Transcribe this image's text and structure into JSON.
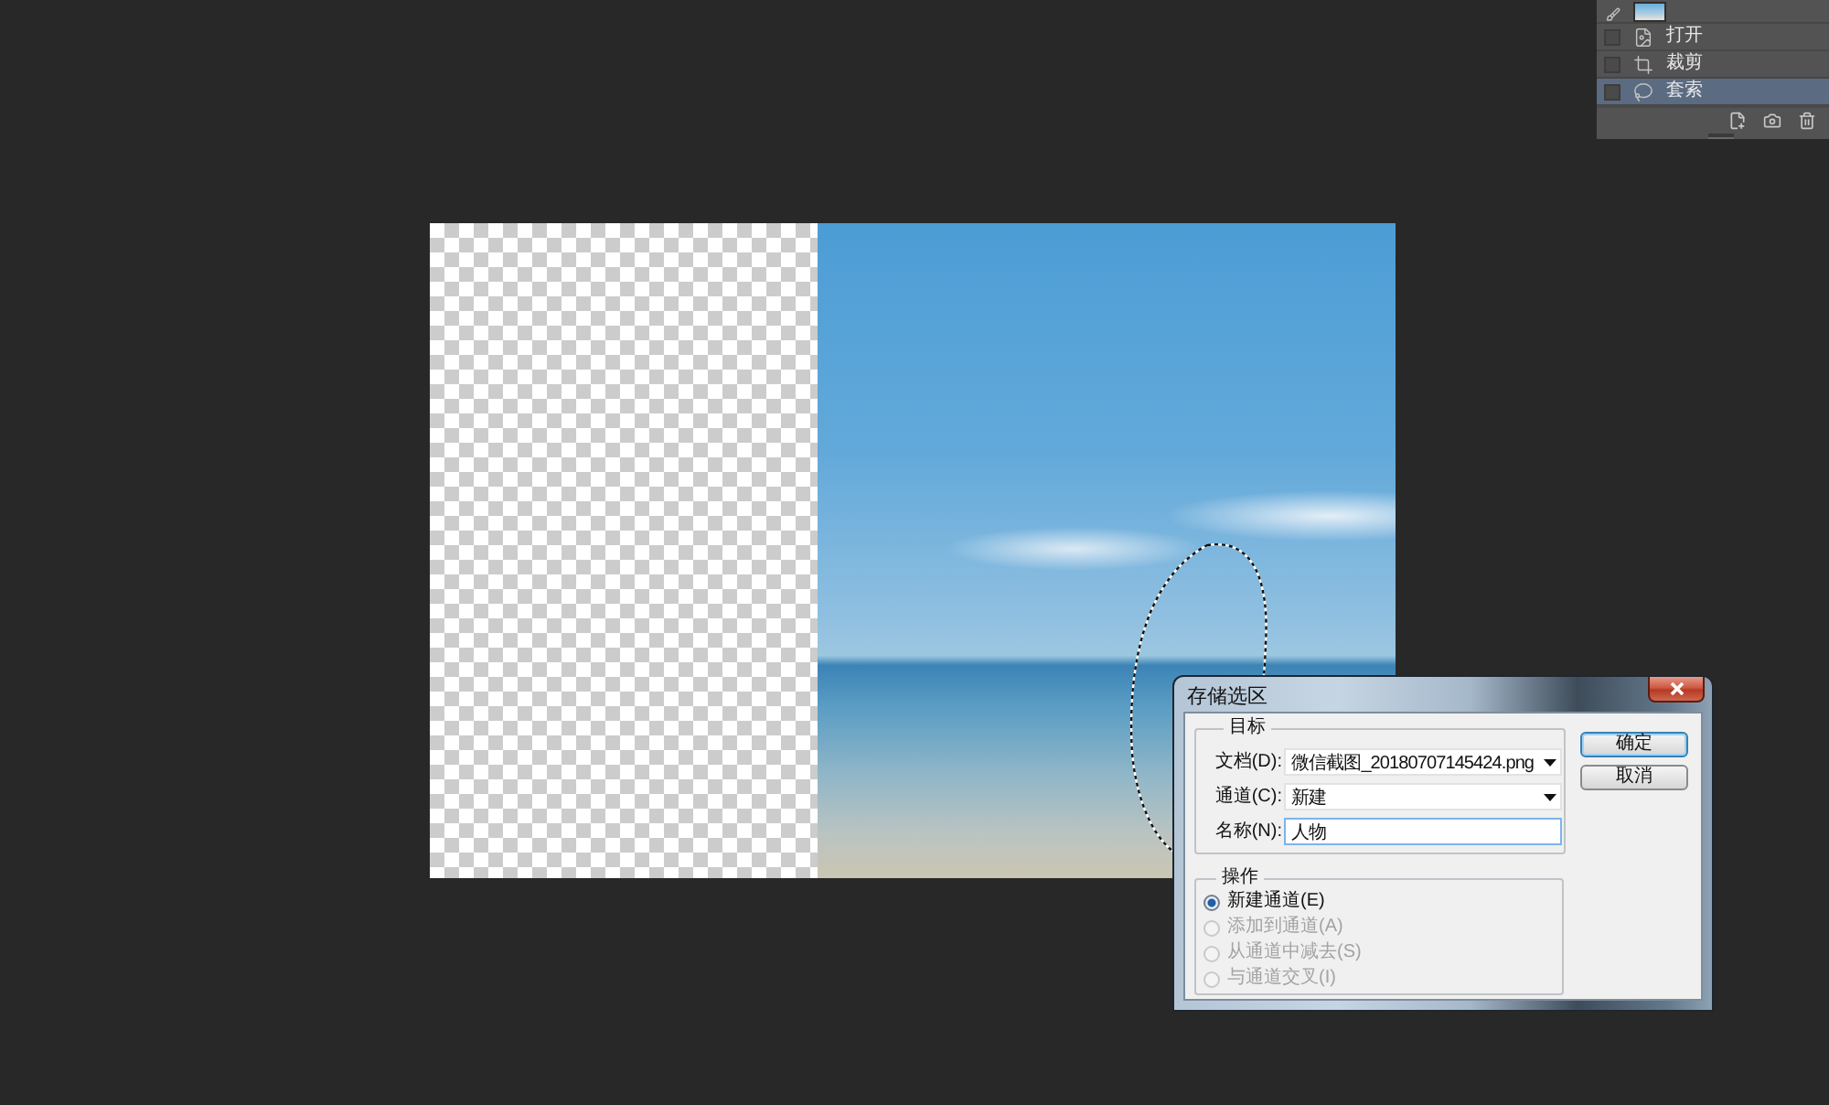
{
  "history_panel": {
    "items": [
      {
        "kind": "open",
        "label": "打开",
        "selected": false
      },
      {
        "kind": "crop",
        "label": "裁剪",
        "selected": false
      },
      {
        "kind": "lasso",
        "label": "套索",
        "selected": true
      }
    ]
  },
  "dialog": {
    "title": "存储选区",
    "destination": {
      "legend": "目标",
      "fields": [
        {
          "kind": "select",
          "label": "文档(D):",
          "value": "微信截图_20180707145424.png",
          "focused": false
        },
        {
          "kind": "select",
          "label": "通道(C):",
          "value": "新建",
          "focused": false
        },
        {
          "kind": "input",
          "label": "名称(N):",
          "value": "人物",
          "focused": true
        }
      ]
    },
    "operation": {
      "legend": "操作",
      "options": [
        {
          "label": "新建通道(E)",
          "selected": true,
          "disabled": false
        },
        {
          "label": "添加到通道(A)",
          "selected": false,
          "disabled": true
        },
        {
          "label": "从通道中减去(S)",
          "selected": false,
          "disabled": true
        },
        {
          "label": "与通道交叉(I)",
          "selected": false,
          "disabled": true
        }
      ]
    },
    "buttons": [
      {
        "label": "确定",
        "default": true
      },
      {
        "label": "取消",
        "default": false
      }
    ]
  }
}
